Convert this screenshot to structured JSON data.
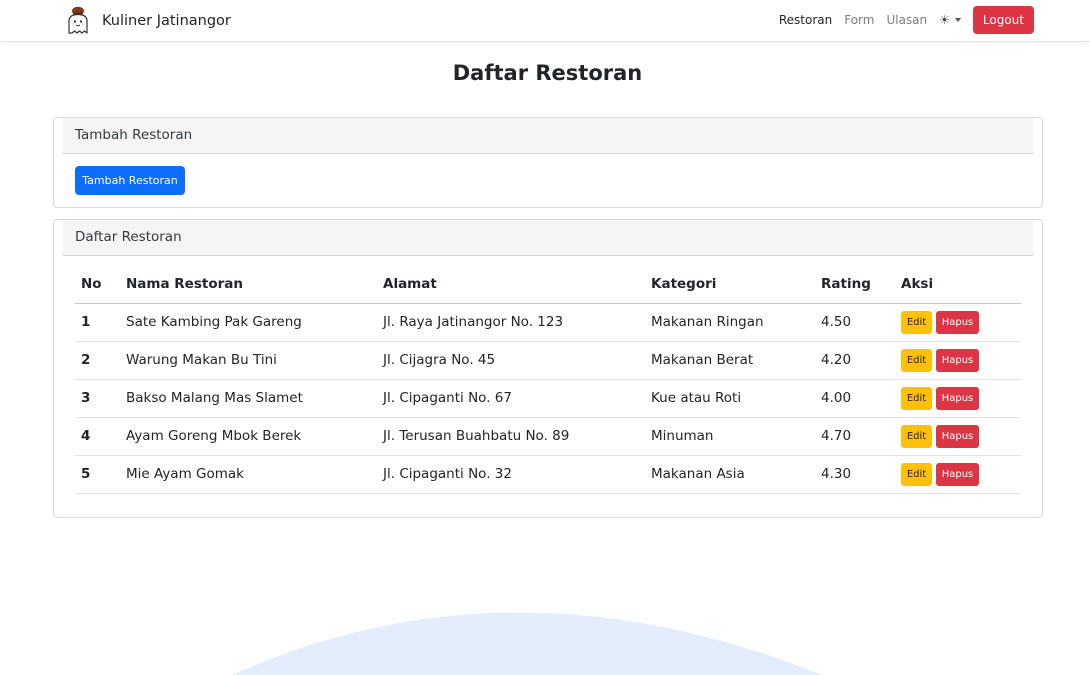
{
  "brand": {
    "name": "Kuliner Jatinangor",
    "logo_icon": "ghost-chef-logo-icon"
  },
  "nav": {
    "links": [
      "Restoran",
      "Form",
      "Ulasan"
    ],
    "theme_icon": "sun-icon",
    "theme_glyph": "☀",
    "logout_label": "Logout"
  },
  "page": {
    "title": "Daftar Restoran"
  },
  "add_card": {
    "header": "Tambah Restoran",
    "button_label": "Tambah Restoran"
  },
  "list_card": {
    "header": "Daftar Restoran",
    "columns": [
      "No",
      "Nama Restoran",
      "Alamat",
      "Kategori",
      "Rating",
      "Aksi"
    ],
    "rows": [
      {
        "no": "1",
        "name": "Sate Kambing Pak Gareng",
        "address": "Jl. Raya Jatinangor No. 123",
        "category": "Makanan Ringan",
        "rating": "4.50"
      },
      {
        "no": "2",
        "name": "Warung Makan Bu Tini",
        "address": "Jl. Cijagra No. 45",
        "category": "Makanan Berat",
        "rating": "4.20"
      },
      {
        "no": "3",
        "name": "Bakso Malang Mas Slamet",
        "address": "Jl. Cipaganti No. 67",
        "category": "Kue atau Roti",
        "rating": "4.00"
      },
      {
        "no": "4",
        "name": "Ayam Goreng Mbok Berek",
        "address": "Jl. Terusan Buahbatu No. 89",
        "category": "Minuman",
        "rating": "4.70"
      },
      {
        "no": "5",
        "name": "Mie Ayam Gomak",
        "address": "Jl. Cipaganti No. 32",
        "category": "Makanan Asia",
        "rating": "4.30"
      }
    ],
    "edit_label": "Edit",
    "delete_label": "Hapus"
  },
  "colors": {
    "primary": "#0d6efd",
    "danger": "#dc3545",
    "warning": "#ffc107",
    "wave": "#e3edfc"
  }
}
